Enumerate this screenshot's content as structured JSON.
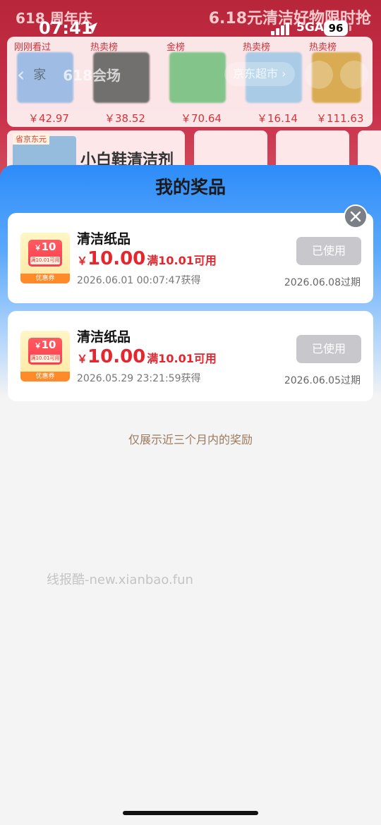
{
  "status_bar": {
    "time": "07:41",
    "network": "5GA",
    "battery": "96"
  },
  "background": {
    "banner_left": "618 周年庆",
    "banner_right": "6.18元清洁好物限时抢",
    "nav_home": "家",
    "nav_title": "618会场",
    "nav_store": "京东超市 ›",
    "rank_columns": [
      {
        "label": "刚刚看过",
        "price": "￥42.97",
        "color": "#8fb6e4"
      },
      {
        "label": "热卖榜",
        "price": "￥38.52",
        "color": "#5b5b5b"
      },
      {
        "label": "金榜",
        "price": "￥70.64",
        "color": "#6fbf7a"
      },
      {
        "label": "热卖榜",
        "price": "￥16.14",
        "color": "#9cc7e6"
      },
      {
        "label": "热卖榜",
        "price": "￥111.63",
        "color": "#d4a33a"
      }
    ],
    "row2_title": "小白鞋清洁剂",
    "row2_tag": "省京东元"
  },
  "sheet": {
    "title": "我的奖品",
    "prizes": [
      {
        "name": "清洁纸品",
        "currency": "￥",
        "amount": "10.00",
        "condition": "满10.01可用",
        "obtained": "2026.06.01 00:07:47获得",
        "status": "已使用",
        "expire": "2026.06.08过期",
        "coupon_amount": "10",
        "coupon_condition": "满10.01可用",
        "coupon_label": "优惠券"
      },
      {
        "name": "清洁纸品",
        "currency": "￥",
        "amount": "10.00",
        "condition": "满10.01可用",
        "obtained": "2026.05.29 23:21:59获得",
        "status": "已使用",
        "expire": "2026.06.05过期",
        "coupon_amount": "10",
        "coupon_condition": "满10.01可用",
        "coupon_label": "优惠券"
      }
    ],
    "footnote": "仅展示近三个月内的奖励"
  },
  "watermark": "线报酷-new.xianbao.fun",
  "colors": {
    "accent_blue": "#2d8cf9",
    "price_red": "#e4262f",
    "used_gray": "#c8c8cc",
    "footnote_brown": "#9c7a5e"
  }
}
